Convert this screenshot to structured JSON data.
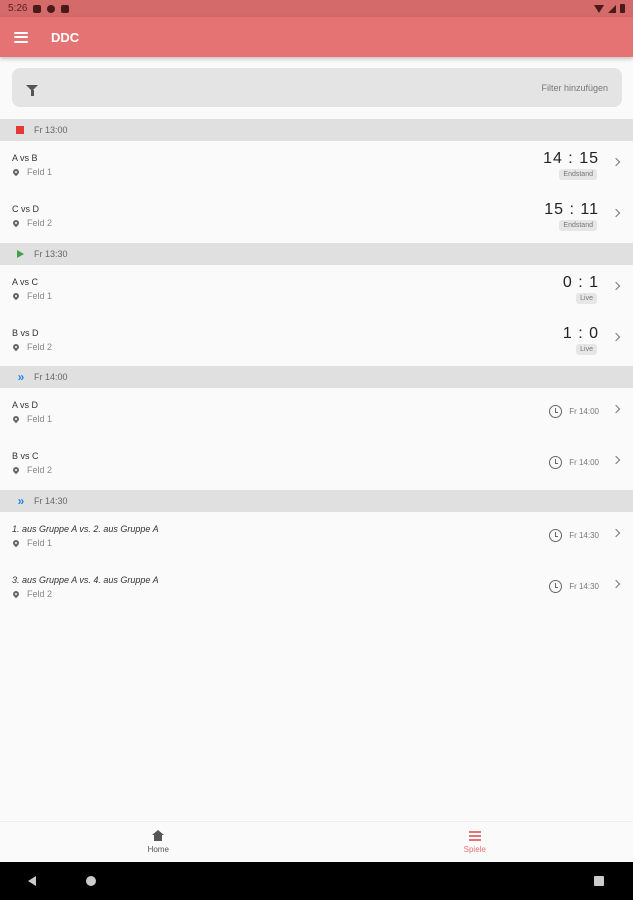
{
  "status_bar": {
    "time": "5:26"
  },
  "app_bar": {
    "title": "DDC"
  },
  "filter": {
    "label": "Filter hinzufügen"
  },
  "groups": [
    {
      "header": "Fr 13:00",
      "status_icon": "stop-icon",
      "games": [
        {
          "title": "A vs B",
          "field": "Feld 1",
          "score": "14 : 15",
          "badge": "Endstand"
        },
        {
          "title": "C vs D",
          "field": "Feld 2",
          "score": "15 : 11",
          "badge": "Endstand"
        }
      ]
    },
    {
      "header": "Fr 13:30",
      "status_icon": "play-icon",
      "games": [
        {
          "title": "A vs C",
          "field": "Feld 1",
          "score": "0 : 1",
          "badge": "Live"
        },
        {
          "title": "B vs D",
          "field": "Feld 2",
          "score": "1 : 0",
          "badge": "Live"
        }
      ]
    },
    {
      "header": "Fr 14:00",
      "status_icon": "fast-forward-icon",
      "games": [
        {
          "title": "A vs D",
          "field": "Feld 1",
          "time": "Fr 14:00"
        },
        {
          "title": "B vs C",
          "field": "Feld 2",
          "time": "Fr 14:00"
        }
      ]
    },
    {
      "header": "Fr 14:30",
      "status_icon": "fast-forward-icon",
      "games": [
        {
          "title": "1. aus Gruppe A vs. 2. aus Gruppe A",
          "field": "Feld 1",
          "time": "Fr 14:30"
        },
        {
          "title": "3. aus Gruppe A vs. 4. aus Gruppe A",
          "field": "Feld 2",
          "time": "Fr 14:30"
        }
      ]
    }
  ],
  "bottom_nav": {
    "home_label": "Home",
    "spiele_label": "Spiele"
  },
  "colors": {
    "primary": "#e57373",
    "status_bar": "#d46a6a",
    "stop": "#e53935",
    "live": "#43a047",
    "upcoming": "#1e88e5"
  }
}
